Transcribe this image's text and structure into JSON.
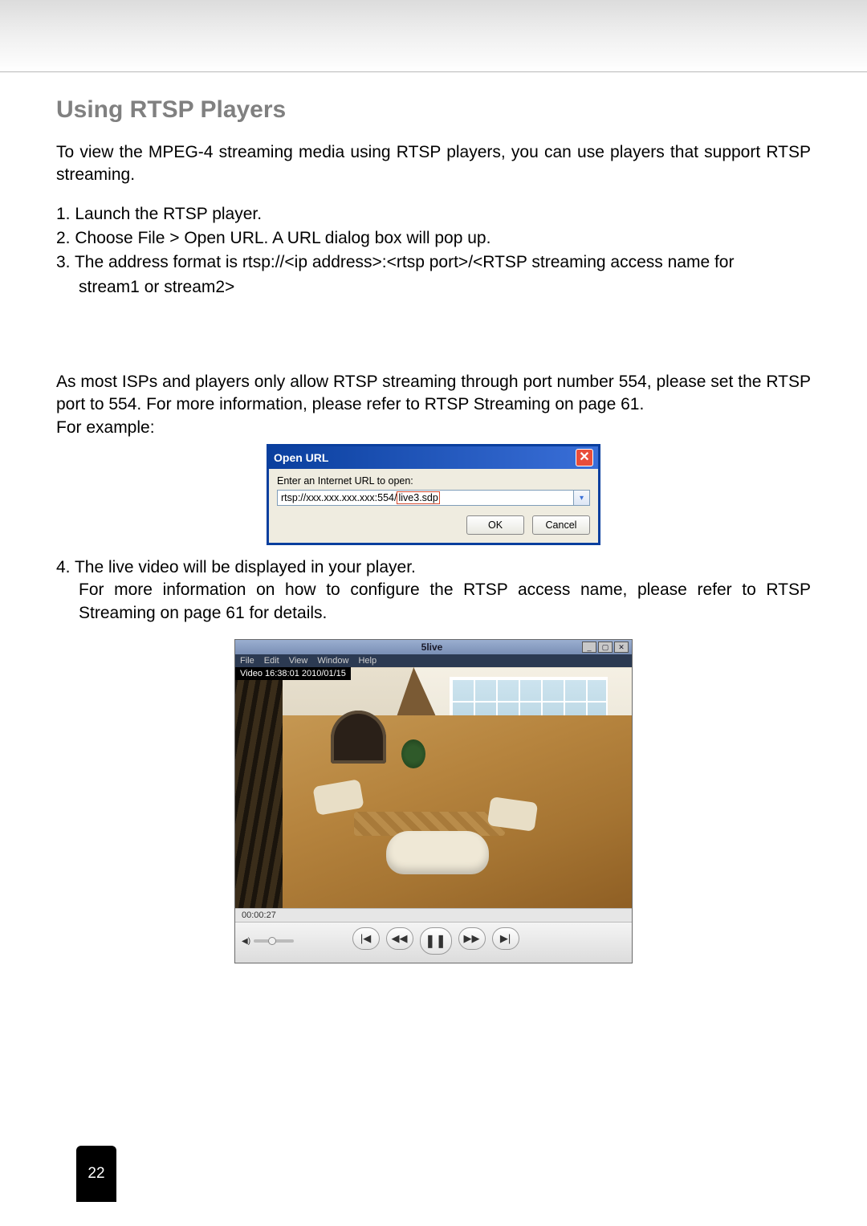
{
  "section_title": "Using RTSP Players",
  "intro": "To view the MPEG-4 streaming media using RTSP players, you can use players that support RTSP streaming.",
  "steps": {
    "s1": "1. Launch the RTSP player.",
    "s2": "2. Choose File > Open URL. A URL dialog box will pop up.",
    "s3a": "3. The address format is rtsp://<ip address>:<rtsp port>/<RTSP streaming access name for",
    "s3b": "stream1 or stream2>"
  },
  "note1": "As most ISPs and players only allow RTSP streaming through port number 554, please set the RTSP port to 554. For more information, please refer to RTSP Streaming on page 61.",
  "note2": "For example:",
  "dialog": {
    "title": "Open URL",
    "label": "Enter an Internet URL to open:",
    "url_prefix": "rtsp://xxx.xxx.xxx.xxx:554/",
    "url_boxed": "live3.sdp",
    "ok": "OK",
    "cancel": "Cancel",
    "close_glyph": "✕"
  },
  "step4": {
    "line1": "4. The live video will be displayed in your player.",
    "line2": "For more information on how to configure the RTSP access name, please refer to RTSP Streaming on page 61 for details."
  },
  "player": {
    "title": "5live",
    "menu": {
      "file": "File",
      "edit": "Edit",
      "view": "View",
      "window": "Window",
      "help": "Help"
    },
    "overlay": "Video 16:38:01 2010/01/15",
    "time": "00:00:27",
    "vol_icon": "◀)",
    "btn_prev": "|◀",
    "btn_rew": "◀◀",
    "btn_pause": "❚❚",
    "btn_ff": "▶▶",
    "btn_next": "▶|",
    "win_min": "_",
    "win_max": "▢",
    "win_close": "✕"
  },
  "page_number": "22"
}
